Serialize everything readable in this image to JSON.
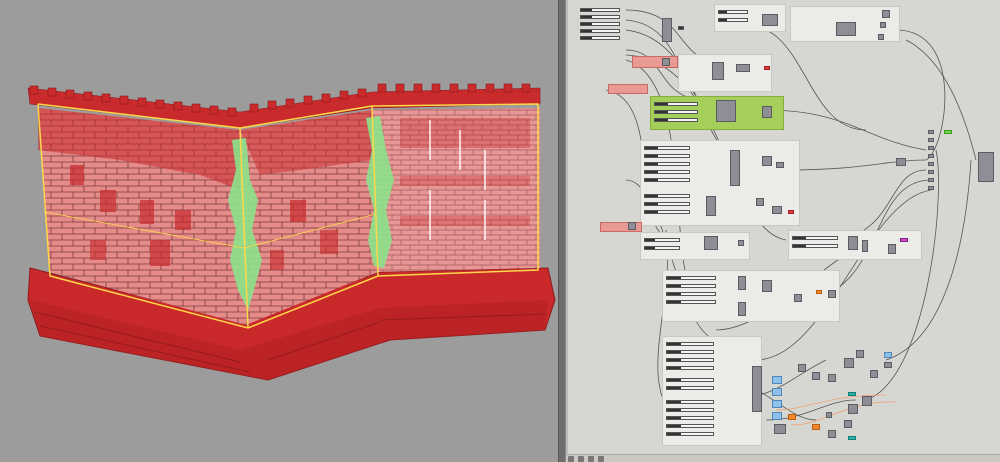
{
  "app": {
    "viewport_name": "3d-wall-preview",
    "canvas_name": "grasshopper-node-canvas"
  },
  "colors": {
    "wall_brick": "#e07a79",
    "wall_dark": "#c92a2c",
    "selection_outline": "#ffd84a",
    "highlight_green": "#8be28a",
    "group_green": "#a6cf5a",
    "group_red": "#e99a93",
    "node_gray": "#8e8e96"
  },
  "status_icons": [
    "grid-icon",
    "search-icon",
    "settings-icon",
    "info-icon"
  ]
}
